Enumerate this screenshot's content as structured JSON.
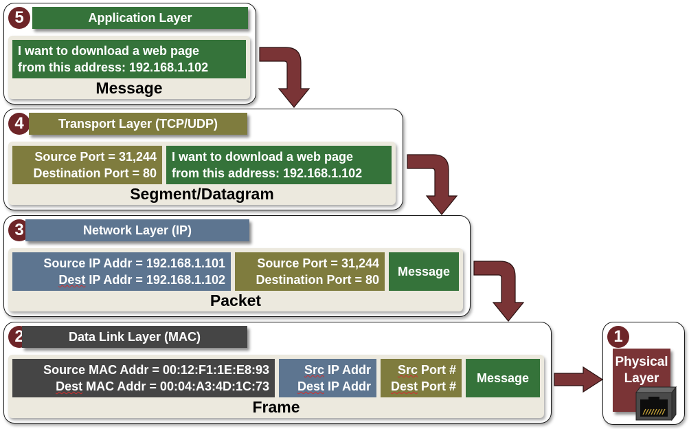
{
  "layers": [
    {
      "number": "5",
      "title": "Application Layer",
      "unit": "Message",
      "fields": [
        {
          "line1": "I want to download a web page",
          "line2": "from this address: 192.168.1.102"
        }
      ]
    },
    {
      "number": "4",
      "title": "Transport Layer (TCP/UDP)",
      "unit": "Segment/Datagram",
      "fields": [
        {
          "line1": "Source Port = 31,244",
          "line2": "Destination Port = 80"
        },
        {
          "line1": "I want to download a web page",
          "line2": "from this address: 192.168.1.102"
        }
      ]
    },
    {
      "number": "3",
      "title": "Network Layer (IP)",
      "unit": "Packet",
      "fields": [
        {
          "line1": "Source IP Addr = 192.168.1.101",
          "line2_a": "Dest",
          "line2_b": " IP Addr = 192.168.1.102"
        },
        {
          "line1": "Source Port = 31,244",
          "line2": "Destination Port = 80"
        },
        {
          "line1": "Message"
        }
      ]
    },
    {
      "number": "2",
      "title": "Data Link Layer (MAC)",
      "unit": "Frame",
      "fields": [
        {
          "line1": "Source MAC Addr = 00:12:F1:1E:E8:93",
          "line2_a": "Dest",
          "line2_b": " MAC Addr = 00:04:A3:4D:1C:73"
        },
        {
          "line1_a": "Src",
          "line1_b": " IP Addr",
          "line2_a": "Dest",
          "line2_b": " IP Addr"
        },
        {
          "line1_a": "Src",
          "line1_b": " Port #",
          "line2_a": "Dest",
          "line2_b": " Port #"
        },
        {
          "line1": "Message"
        }
      ]
    },
    {
      "number": "1",
      "title_line1": "Physical",
      "title_line2": "Layer",
      "icon": "ethernet-port-icon"
    }
  ],
  "colors": {
    "application": "#35733a",
    "transport": "#7f7c3e",
    "network": "#5d7590",
    "datalink": "#454545",
    "physical": "#7a3436",
    "arrow": "#7a3436",
    "badge": "#6e2528"
  }
}
